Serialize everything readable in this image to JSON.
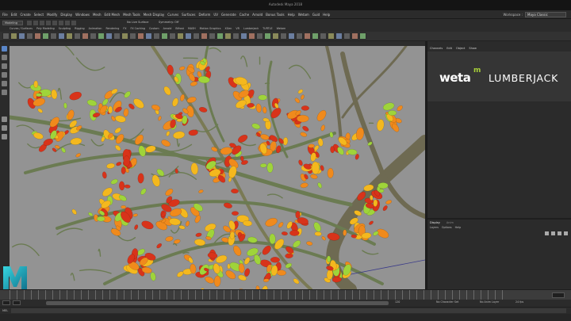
{
  "window": {
    "title": "Autodesk Maya 2018"
  },
  "menubar": {
    "items": [
      "File",
      "Edit",
      "Create",
      "Select",
      "Modify",
      "Display",
      "Windows",
      "Mesh",
      "Edit Mesh",
      "Mesh Tools",
      "Mesh Display",
      "Curves",
      "Surfaces",
      "Deform",
      "UV",
      "Generate",
      "Cache",
      "Arnold",
      "Bonus Tools",
      "Help",
      "Wetam",
      "Guid",
      "Help"
    ],
    "workspace_label": "Workspace :",
    "workspace_value": "Maya Classic"
  },
  "statusline": {
    "mode": "Modeling",
    "symmetry": "No Live Surface",
    "symmetry_label": "Symmetry: Off"
  },
  "shelf": {
    "tabs": [
      "Curves / Surfaces",
      "Poly Modeling",
      "Sculpting",
      "Rigging",
      "Animation",
      "Rendering",
      "FX",
      "FX Caching",
      "Custom",
      "Arnold",
      "Bifrost",
      "MASH",
      "Motion Graphics",
      "XGen",
      "VR",
      "Lumberjack",
      "TURTLE",
      "Wetam"
    ]
  },
  "right_panel": {
    "tabs": [
      "Channels",
      "Edit",
      "Object",
      "Show"
    ],
    "brand_weta": "weta",
    "brand_m": "m",
    "brand_product": "LUMBERJACK",
    "layer_tabs": [
      "Display",
      "Anim"
    ],
    "layer_menu": [
      "Layers",
      "Options",
      "Help"
    ]
  },
  "rangebar": {
    "start": "1",
    "end": "120",
    "layer": "No Character Set",
    "anim_layer": "No Anim Layer",
    "fps": "24 fps"
  },
  "commandline": {
    "label": "MEL"
  },
  "colors": {
    "viewport_bg": "#939393",
    "accent_lime": "#a6ce39",
    "leaf_orange": "#f08a1c",
    "leaf_red": "#d8331a",
    "leaf_yellow": "#f4b81e",
    "leaf_green": "#9fd43a",
    "branch": "#6b7b52"
  }
}
